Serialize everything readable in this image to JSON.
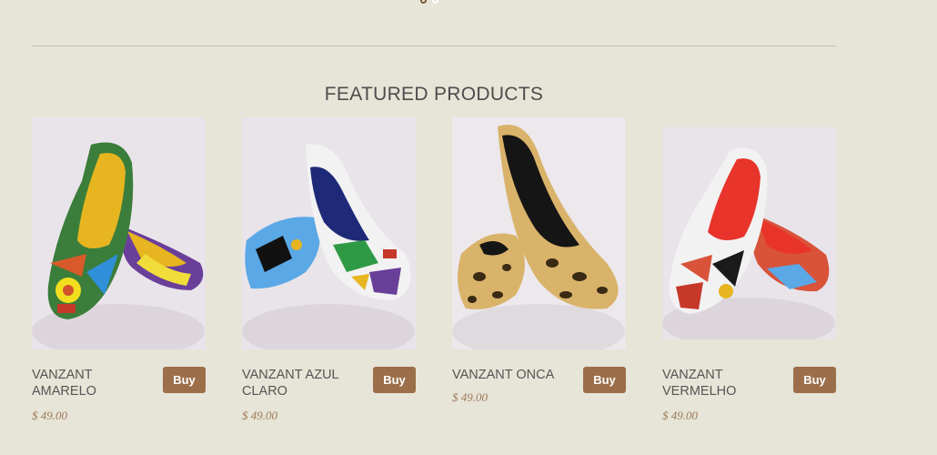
{
  "carousel": {
    "dots": 2,
    "active_index": 0
  },
  "section": {
    "title": "FEATURED PRODUCTS"
  },
  "products": [
    {
      "name": "VANZANT AMARELO",
      "price": "$ 49.00",
      "buy_label": "Buy",
      "insole_color": "#e6b520",
      "pattern": "colorful"
    },
    {
      "name": "VANZANT AZUL CLARO",
      "price": "$ 49.00",
      "buy_label": "Buy",
      "insole_color": "#1e2a78",
      "pattern": "blue"
    },
    {
      "name": "VANZANT ONCA",
      "price": "$ 49.00",
      "buy_label": "Buy",
      "insole_color": "#151515",
      "pattern": "leopard"
    },
    {
      "name": "VANZANT VERMELHO",
      "price": "$ 49.00",
      "buy_label": "Buy",
      "insole_color": "#e8342a",
      "pattern": "red"
    }
  ],
  "colors": {
    "background": "#e7e4d8",
    "button": "#9c6f4a",
    "price": "#9c7a58"
  }
}
